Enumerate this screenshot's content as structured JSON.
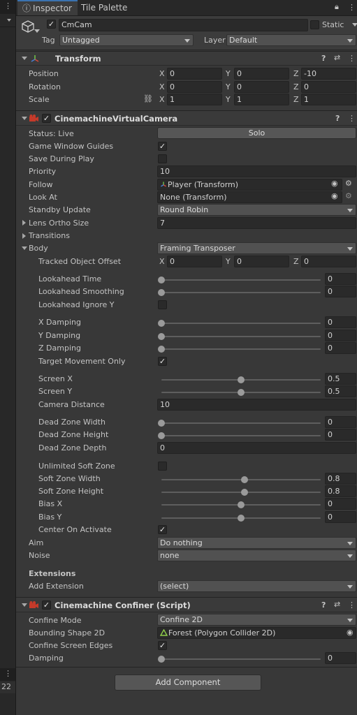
{
  "tabs": {
    "inspector": "Inspector",
    "tile_palette": "Tile Palette"
  },
  "object": {
    "name": "CmCam",
    "static_label": "Static",
    "tag_label": "Tag",
    "tag_value": "Untagged",
    "layer_label": "Layer",
    "layer_value": "Default"
  },
  "transform": {
    "title": "Transform",
    "position_label": "Position",
    "rotation_label": "Rotation",
    "scale_label": "Scale",
    "axis_x": "X",
    "axis_y": "Y",
    "axis_z": "Z",
    "position": {
      "x": "0",
      "y": "0",
      "z": "-10"
    },
    "rotation": {
      "x": "0",
      "y": "0",
      "z": "0"
    },
    "scale": {
      "x": "1",
      "y": "1",
      "z": "1"
    }
  },
  "vcam": {
    "title": "CinemachineVirtualCamera",
    "status_label": "Status: Live",
    "solo_label": "Solo",
    "game_window_guides_label": "Game Window Guides",
    "save_during_play_label": "Save During Play",
    "priority_label": "Priority",
    "priority_value": "10",
    "follow_label": "Follow",
    "follow_value": "Player (Transform)",
    "look_at_label": "Look At",
    "look_at_value": "None (Transform)",
    "standby_label": "Standby Update",
    "standby_value": "Round Robin",
    "lens_label": "Lens Ortho Size",
    "lens_value": "7",
    "transitions_label": "Transitions",
    "body_label": "Body",
    "body_value": "Framing Transposer",
    "tracked_offset_label": "Tracked Object Offset",
    "tracked_offset": {
      "x": "0",
      "y": "0",
      "z": "0"
    },
    "lookahead_time_label": "Lookahead Time",
    "lookahead_time": "0",
    "lookahead_smoothing_label": "Lookahead Smoothing",
    "lookahead_smoothing": "0",
    "lookahead_ignore_y_label": "Lookahead Ignore Y",
    "x_damping_label": "X Damping",
    "x_damping": "0",
    "y_damping_label": "Y Damping",
    "y_damping": "0",
    "z_damping_label": "Z Damping",
    "z_damping": "0",
    "target_movement_only_label": "Target Movement Only",
    "screen_x_label": "Screen X",
    "screen_x": "0.5",
    "screen_y_label": "Screen Y",
    "screen_y": "0.5",
    "camera_distance_label": "Camera Distance",
    "camera_distance": "10",
    "dead_zone_width_label": "Dead Zone Width",
    "dead_zone_width": "0",
    "dead_zone_height_label": "Dead Zone Height",
    "dead_zone_height": "0",
    "dead_zone_depth_label": "Dead Zone Depth",
    "dead_zone_depth": "0",
    "unlimited_soft_zone_label": "Unlimited Soft Zone",
    "soft_zone_width_label": "Soft Zone Width",
    "soft_zone_width": "0.8",
    "soft_zone_height_label": "Soft Zone Height",
    "soft_zone_height": "0.8",
    "bias_x_label": "Bias X",
    "bias_x": "0",
    "bias_y_label": "Bias Y",
    "bias_y": "0",
    "center_on_activate_label": "Center On Activate",
    "aim_label": "Aim",
    "aim_value": "Do nothing",
    "noise_label": "Noise",
    "noise_value": "none",
    "extensions_label": "Extensions",
    "add_extension_label": "Add Extension",
    "add_extension_value": "(select)"
  },
  "confiner": {
    "title": "Cinemachine Confiner (Script)",
    "confine_mode_label": "Confine Mode",
    "confine_mode_value": "Confine 2D",
    "bounding_shape_label": "Bounding Shape 2D",
    "bounding_shape_value": "Forest (Polygon Collider 2D)",
    "confine_screen_edges_label": "Confine Screen Edges",
    "damping_label": "Damping",
    "damping": "0"
  },
  "add_component_label": "Add Component",
  "left_strip": {
    "number": "22"
  },
  "colors": {
    "accent": "#3a72b0",
    "background": "#383838",
    "field": "#2a2a2a"
  }
}
